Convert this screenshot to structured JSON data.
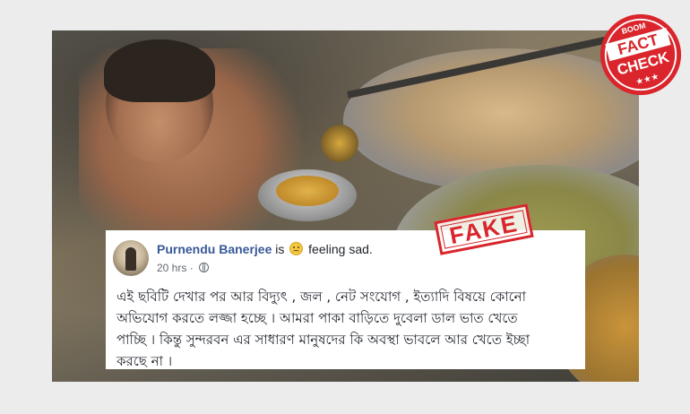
{
  "post": {
    "author": "Purnendu Banerjee",
    "is_text": "is",
    "feeling_text": "feeling sad.",
    "time": "20 hrs",
    "dot": "·",
    "body_lines": [
      "এই ছবিটি দেখার পর আর বিদ্যুৎ , জল , নেট সংযোগ , ইত্যাদি বিষয়ে কোনো",
      "অভিযোগ করতে লজ্জা হচ্ছে । আমরা পাকা বাড়িতে দুবেলা ডাল ভাত খেতে",
      "পাচ্ছি । কিন্তু সুন্দরবন এর সাধারণ মানুষদের কি অবস্থা ভাবলে আর খেতে ইচ্ছা",
      "করছে না ।"
    ]
  },
  "stamp": {
    "label": "FAKE",
    "color": "#d9252b"
  },
  "badge": {
    "top": "BOOM",
    "line1": "FACT",
    "line2": "CHECK",
    "stars": "★★★",
    "color": "#d9252b"
  },
  "icons": {
    "globe": "globe-icon",
    "emoji": "sad-face-icon"
  }
}
